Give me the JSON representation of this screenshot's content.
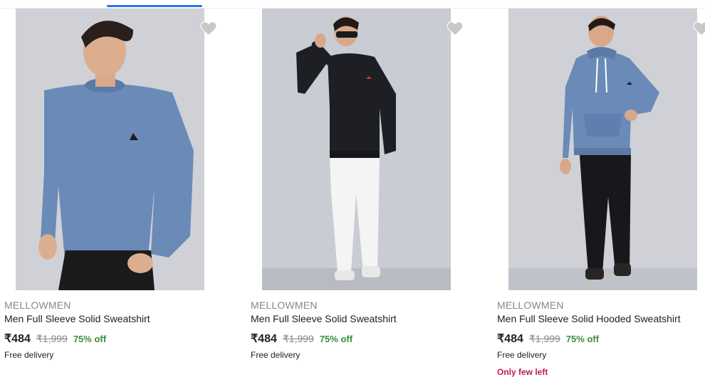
{
  "colors": {
    "tab_underline": "#2874f0",
    "brand_text": "#878787",
    "discount": "#388e3c",
    "low_stock": "#c2185b"
  },
  "products": [
    {
      "brand": "MELLOWMEN",
      "title": "Men Full Sleeve Solid Sweatshirt",
      "price": "₹484",
      "mrp": "₹1,999",
      "discount": "75% off",
      "delivery": "Free delivery",
      "image_subject": "model in blue crew-neck sweatshirt",
      "wishlist_icon": "heart-icon"
    },
    {
      "brand": "MELLOWMEN",
      "title": "Men Full Sleeve Solid Sweatshirt",
      "price": "₹484",
      "mrp": "₹1,999",
      "discount": "75% off",
      "delivery": "Free delivery",
      "image_subject": "model in black sweatshirt with white trousers",
      "wishlist_icon": "heart-icon"
    },
    {
      "brand": "MELLOWMEN",
      "title": "Men Full Sleeve Solid Hooded Sweatshirt",
      "price": "₹484",
      "mrp": "₹1,999",
      "discount": "75% off",
      "delivery": "Free delivery",
      "stock_note": "Only few left",
      "image_subject": "model in blue hooded sweatshirt",
      "wishlist_icon": "heart-icon"
    }
  ]
}
